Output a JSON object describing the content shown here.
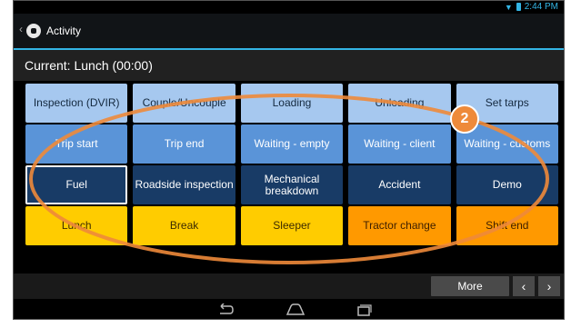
{
  "status_bar": {
    "time": "2:44 PM",
    "wifi_icon": "wifi-icon",
    "battery_icon": "battery-icon"
  },
  "action_bar": {
    "title": "Activity",
    "logo_icon": "app-logo-icon"
  },
  "current_activity": "Current: Lunch (00:00)",
  "tiles": [
    {
      "label": "Inspection (DVIR)",
      "style": "light"
    },
    {
      "label": "Couple/Uncouple",
      "style": "light"
    },
    {
      "label": "Loading",
      "style": "light"
    },
    {
      "label": "Unloading",
      "style": "light"
    },
    {
      "label": "Set tarps",
      "style": "light"
    },
    {
      "label": "Trip start",
      "style": "mid"
    },
    {
      "label": "Trip end",
      "style": "mid"
    },
    {
      "label": "Waiting - empty",
      "style": "mid"
    },
    {
      "label": "Waiting - client",
      "style": "mid"
    },
    {
      "label": "Waiting - customs",
      "style": "mid"
    },
    {
      "label": "Fuel",
      "style": "dark",
      "selected": true
    },
    {
      "label": "Roadside inspection",
      "style": "dark"
    },
    {
      "label": "Mechanical breakdown",
      "style": "dark"
    },
    {
      "label": "Accident",
      "style": "dark"
    },
    {
      "label": "Demo",
      "style": "dark"
    },
    {
      "label": "Lunch",
      "style": "yellow"
    },
    {
      "label": "Break",
      "style": "yellow"
    },
    {
      "label": "Sleeper",
      "style": "yellow"
    },
    {
      "label": "Tractor change",
      "style": "orange"
    },
    {
      "label": "Shift end",
      "style": "orange"
    }
  ],
  "bottom_bar": {
    "more_label": "More",
    "prev_label": "‹",
    "next_label": "›"
  },
  "system_nav": {
    "back_icon": "back-icon",
    "home_icon": "home-icon",
    "recents_icon": "recent-apps-icon"
  },
  "annotation": {
    "badge_number": "2",
    "color": "#ee8a3a"
  }
}
